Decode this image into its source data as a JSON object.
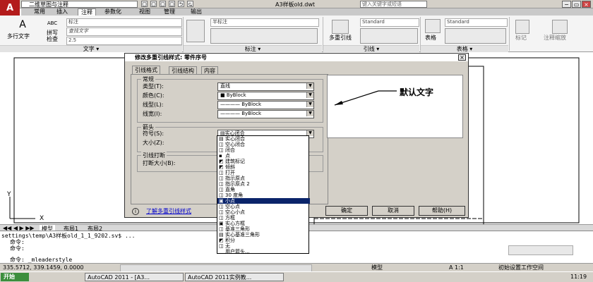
{
  "titlebar": {
    "workspace": "二维草图与注释",
    "title": "A3样板old.dwt",
    "search_placeholder": "键入关键字或短语",
    "tool_icons": [
      "▢",
      "▢",
      "▢",
      "▢",
      "⮌",
      "⮎"
    ],
    "win_buttons": [
      "−",
      "▭",
      "×"
    ]
  },
  "ribbon": {
    "tabs": [
      "常用",
      "插入",
      "注释",
      "参数化",
      "视图",
      "管理",
      "输出"
    ],
    "active_tab": "注释",
    "left_buttons": [
      {
        "icon": "A",
        "label": "多行文字"
      },
      {
        "icon": "ABC",
        "label": "拼写\n检查"
      }
    ],
    "text_style": "标注",
    "text_search_placeholder": "查找文字",
    "text_height": "2.5",
    "panel_text": "文字 ▾",
    "dim_style": "半标注",
    "panel_dim": "标注 ▾",
    "mleader_style": "Standard",
    "mleader_btn": "多重引线",
    "panel_mleader": "引线 ▾",
    "table_style": "Standard",
    "table_btn": "表格",
    "panel_table": "表格 ▾",
    "markup_btn": "标记",
    "scale_btn": "注释缩放"
  },
  "dialog": {
    "title": "修改多重引线样式: 零件序号",
    "tabs": [
      "引线格式",
      "引线结构",
      "内容"
    ],
    "group_general": "常规",
    "type_label": "类型(T):",
    "type_value": "直线",
    "color_label": "颜色(C):",
    "color_value": "■ ByBlock",
    "linetype_label": "线型(L):",
    "linetype_value": "———— ByBlock",
    "lineweight_label": "线宽(I):",
    "lineweight_value": "———— ByBlock",
    "group_arrow": "箭头",
    "symbol_label": "符号(S):",
    "symbol_value": "▤实心闭合",
    "size_label": "大小(Z):",
    "group_break": "引线打断",
    "breaksize_label": "打断大小(B):",
    "preview_text": "默认文字",
    "help_link": "了解多重引线样式",
    "ok": "确定",
    "cancel": "取消",
    "help": "帮助(H)"
  },
  "arrow_options": [
    {
      "glyph": "▤",
      "label": "实心闭合"
    },
    {
      "glyph": "◫",
      "label": "空心闭合"
    },
    {
      "glyph": "◫",
      "label": "闭合"
    },
    {
      "glyph": "▪",
      "label": "点"
    },
    {
      "glyph": "◩",
      "label": "建筑标记"
    },
    {
      "glyph": "◩",
      "label": "倾斜"
    },
    {
      "glyph": "◫",
      "label": "打开"
    },
    {
      "glyph": "◫",
      "label": "指示原点"
    },
    {
      "glyph": "◫",
      "label": "指示原点 2"
    },
    {
      "glyph": "◫",
      "label": "直角"
    },
    {
      "glyph": "◫",
      "label": "30 度角"
    },
    {
      "glyph": "▣",
      "label": "小点"
    },
    {
      "glyph": "◫",
      "label": "空心点"
    },
    {
      "glyph": "◫",
      "label": "空心小点"
    },
    {
      "glyph": "◫",
      "label": "方框"
    },
    {
      "glyph": "▣",
      "label": "实心方框"
    },
    {
      "glyph": "◫",
      "label": "基准三角形"
    },
    {
      "glyph": "▤",
      "label": "实心基准三角形"
    },
    {
      "glyph": "◩",
      "label": "积分"
    },
    {
      "glyph": "◫",
      "label": "无"
    },
    {
      "glyph": "",
      "label": "用户箭头..."
    }
  ],
  "selected_option": 11,
  "layout_tabs": [
    "模型",
    "布局1",
    "布局2"
  ],
  "command": {
    "lines": [
      "settings\\temp\\A3样板old_1_1_9202.sv$ ...",
      "命令:",
      "命令:",
      "命令: _mleaderstyle"
    ]
  },
  "status": {
    "coords": "335.5712,  339.1459, 0.0000",
    "model": "模型",
    "scale": "A 1:1",
    "mode": "初始设置工作空间"
  },
  "taskbar": {
    "start": "开始",
    "apps": [
      "AutoCAD 2011 - [A3...",
      "AutoCAD 2011实例教..."
    ],
    "clock": "11:19"
  },
  "colors": {
    "selection": "#0a246a",
    "logo": "#b31b1b"
  }
}
